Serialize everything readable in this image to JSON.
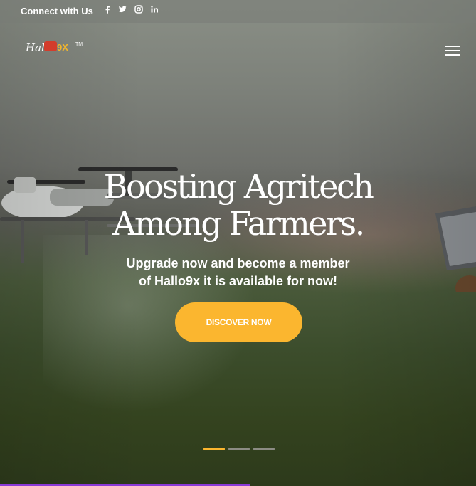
{
  "topbar": {
    "connect_label": "Connect with Us",
    "social_icons": [
      "facebook-icon",
      "twitter-icon",
      "instagram-icon",
      "linkedin-icon"
    ]
  },
  "logo": {
    "text_hall": "Hall",
    "text_9x": "9X",
    "text_tm": "TM"
  },
  "hero": {
    "headline_line1": "Boosting Agritech",
    "headline_line2": "Among Farmers.",
    "subtitle_line1": "Upgrade now and become a member",
    "subtitle_line2": "of Hallo9x it is available for now!",
    "cta_label": "DISCOVER NOW"
  },
  "slider": {
    "slide_count": 3,
    "active_slide": 1
  },
  "colors": {
    "accent": "#fbb62f",
    "progress": "#8a39d6",
    "dot_inactive": "#8c8c84"
  }
}
